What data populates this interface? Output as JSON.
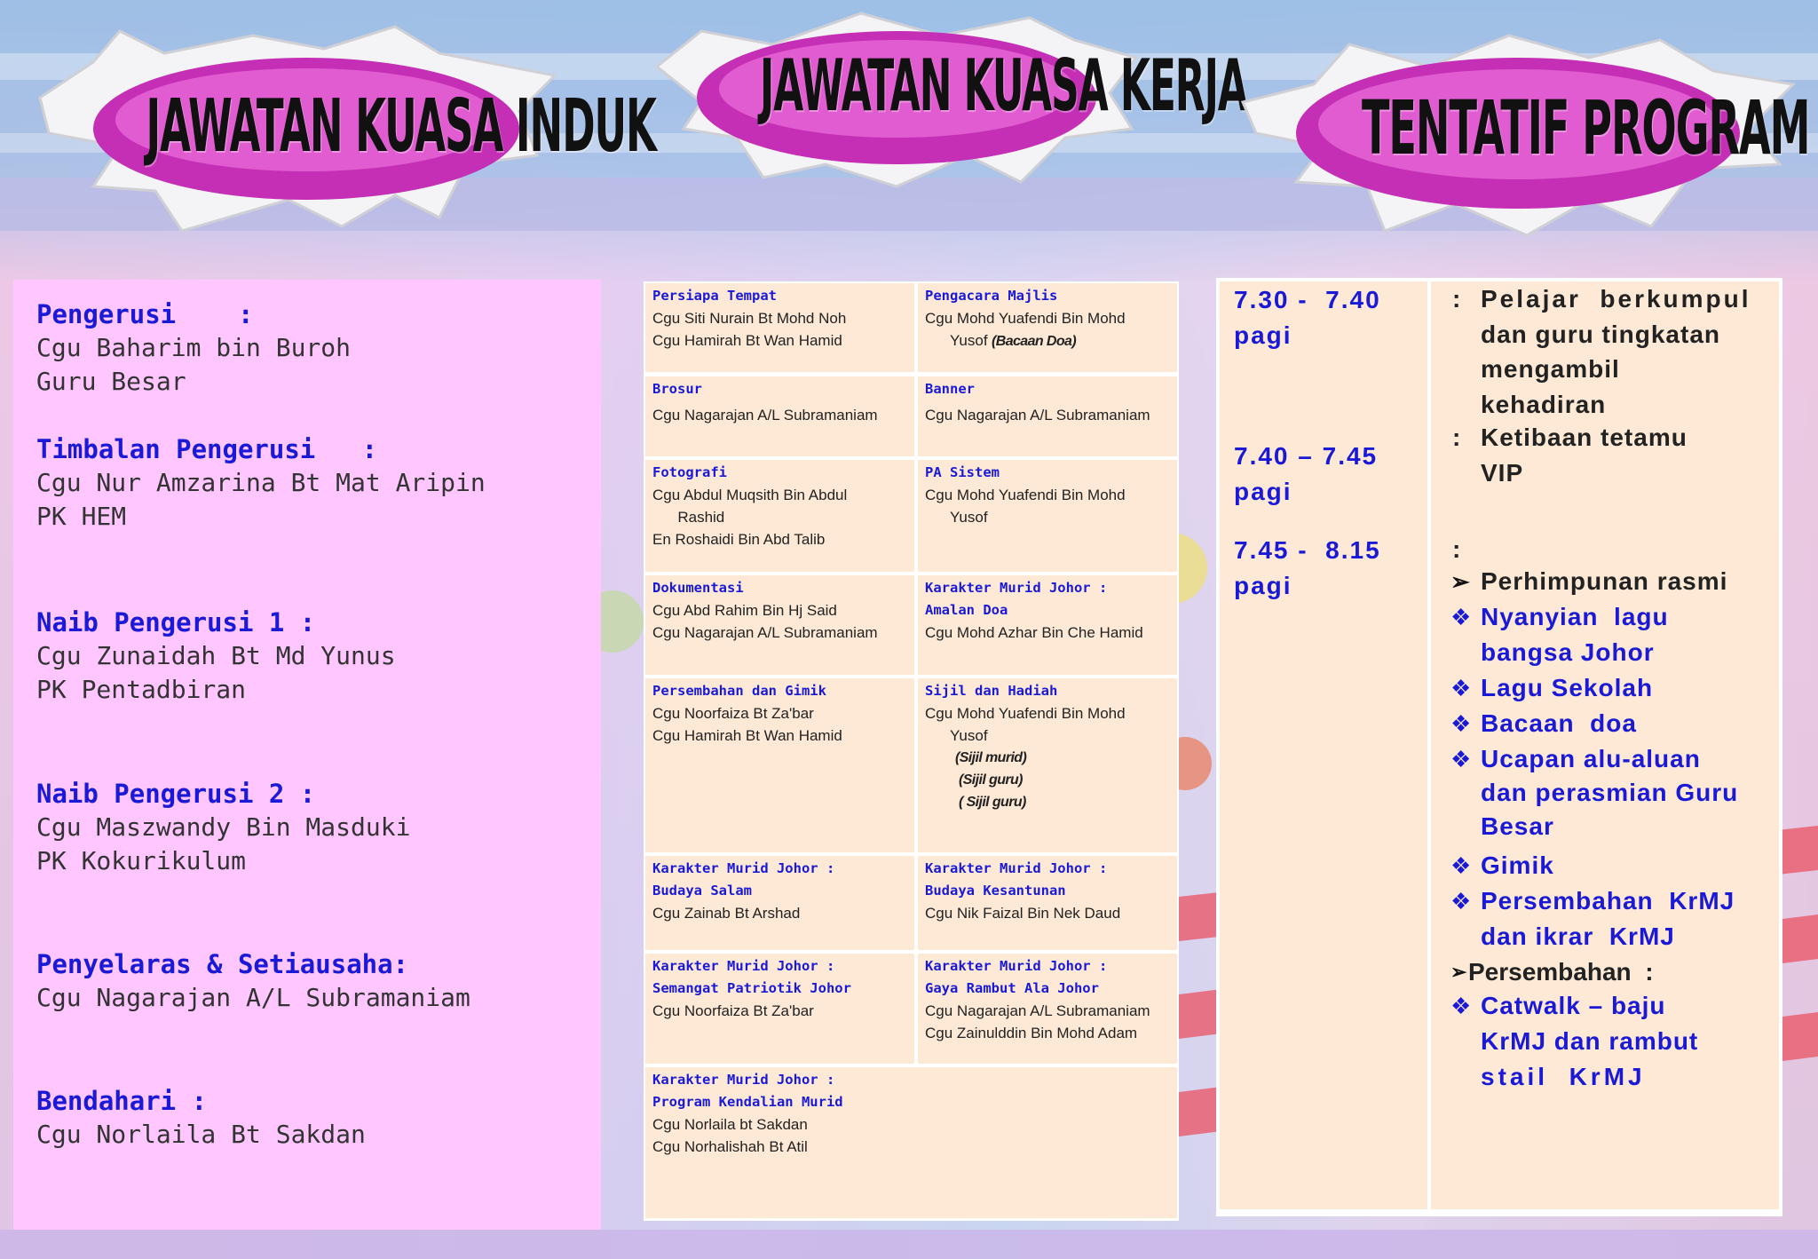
{
  "header": {
    "badges": [
      {
        "title": "JAWATAN  KUASA  INDUK"
      },
      {
        "title": "JAWATAN  KUASA  KERJA"
      },
      {
        "title": "TENTATIF  PROGRAM"
      }
    ]
  },
  "induk": [
    {
      "role": "Pengerusi    :",
      "lines": [
        "Cgu Baharim bin Buroh",
        "Guru Besar"
      ]
    },
    {
      "role": "Timbalan Pengerusi   :",
      "lines": [
        "Cgu Nur Amzarina Bt Mat Aripin",
        "PK HEM"
      ]
    },
    {
      "role": "Naib Pengerusi 1 :",
      "lines": [
        "Cgu Zunaidah Bt Md Yunus",
        "PK Pentadbiran"
      ]
    },
    {
      "role": "Naib Pengerusi 2 :",
      "lines": [
        "Cgu Maszwandy Bin Masduki",
        "PK Kokurikulum"
      ]
    },
    {
      "role": "Penyelaras & Setiausaha:",
      "lines": [
        "Cgu Nagarajan A/L Subramaniam"
      ]
    },
    {
      "role": "Bendahari :",
      "lines": [
        "Cgu Norlaila Bt Sakdan"
      ]
    }
  ],
  "kerja": [
    {
      "heads": [
        "Persiapa Tempat"
      ],
      "names": [
        "Cgu Siti Nurain Bt Mohd Noh",
        "Cgu Hamirah Bt Wan Hamid"
      ],
      "notes": []
    },
    {
      "heads": [
        "Pengacara Majlis"
      ],
      "names": [
        "Cgu Mohd Yuafendi Bin Mohd",
        "      Yusof"
      ],
      "inline_note": "(Bacaan Doa)",
      "notes": []
    },
    {
      "heads": [
        "Brosur"
      ],
      "names": [
        "Cgu Nagarajan A/L Subramaniam"
      ],
      "notes": []
    },
    {
      "heads": [
        "Banner"
      ],
      "names": [
        "Cgu Nagarajan A/L Subramaniam"
      ],
      "notes": []
    },
    {
      "heads": [
        "Fotografi"
      ],
      "names": [
        "Cgu Abdul Muqsith Bin Abdul",
        "      Rashid",
        "En Roshaidi Bin Abd Talib"
      ],
      "notes": []
    },
    {
      "heads": [
        "PA Sistem"
      ],
      "names": [
        "Cgu Mohd Yuafendi Bin Mohd",
        "      Yusof"
      ],
      "notes": []
    },
    {
      "heads": [
        "Dokumentasi"
      ],
      "names": [
        "Cgu Abd Rahim Bin Hj Said",
        "Cgu Nagarajan A/L Subramaniam"
      ],
      "notes": []
    },
    {
      "heads": [
        "Karakter Murid Johor :",
        "Amalan Doa"
      ],
      "names": [
        "Cgu Mohd Azhar Bin Che Hamid"
      ],
      "notes": []
    },
    {
      "heads": [
        "Persembahan dan Gimik"
      ],
      "names": [
        "Cgu Noorfaiza Bt Za'bar",
        "Cgu Hamirah Bt Wan Hamid"
      ],
      "notes": []
    },
    {
      "heads": [
        "Sijil dan Hadiah"
      ],
      "names": [
        "Cgu Mohd Yuafendi Bin Mohd",
        "      Yusof"
      ],
      "notes": [
        "(Sijil murid)",
        "(Sijil guru)",
        "( Sijil guru)"
      ]
    },
    {
      "heads": [
        "Karakter Murid Johor :",
        "Budaya Salam"
      ],
      "names": [
        "Cgu Zainab Bt Arshad"
      ],
      "notes": []
    },
    {
      "heads": [
        "Karakter Murid Johor :",
        "Budaya Kesantunan"
      ],
      "names": [
        "Cgu Nik Faizal Bin Nek Daud"
      ],
      "notes": []
    },
    {
      "heads": [
        "Karakter Murid Johor :",
        "Semangat Patriotik Johor"
      ],
      "names": [
        "Cgu Noorfaiza Bt Za'bar"
      ],
      "notes": []
    },
    {
      "heads": [
        "Karakter Murid Johor :",
        "Gaya Rambut Ala Johor"
      ],
      "names": [
        "Cgu Nagarajan A/L Subramaniam",
        "Cgu Zainulddin Bin Mohd Adam"
      ],
      "notes": []
    },
    {
      "heads": [
        "Karakter Murid Johor :",
        "Program Kendalian Murid"
      ],
      "names": [
        "Cgu Norlaila bt Sakdan",
        "Cgu Norhalishah Bt Atil"
      ],
      "notes": []
    }
  ],
  "tentatif": {
    "times": [
      "7.30 -  7.40",
      "pagi",
      "7.40 – 7.45",
      "pagi",
      "7.45 -  8.15",
      "pagi"
    ],
    "colon_1": ":",
    "act_1": [
      "Pelajar  berkumpul",
      "dan guru tingkatan",
      "mengambil",
      "kehadiran"
    ],
    "colon_2": ":",
    "act_2": [
      "Ketibaan tetamu",
      "VIP"
    ],
    "colon_3": ":",
    "arrow_1": "Perhimpunan rasmi",
    "items_a": [
      [
        "Nyanyian  lagu",
        "bangsa Johor"
      ],
      [
        "Lagu Sekolah"
      ],
      [
        "Bacaan  doa"
      ],
      [
        "Ucapan alu-aluan",
        "dan perasmian Guru",
        "Besar"
      ],
      [
        "Gimik"
      ],
      [
        "Persembahan  KrMJ",
        "dan ikrar  KrMJ"
      ]
    ],
    "arrow_2": "Persembahan  :",
    "items_b": [
      [
        "Catwalk – baju",
        "KrMJ dan rambut",
        "stail  KrMJ"
      ]
    ]
  }
}
